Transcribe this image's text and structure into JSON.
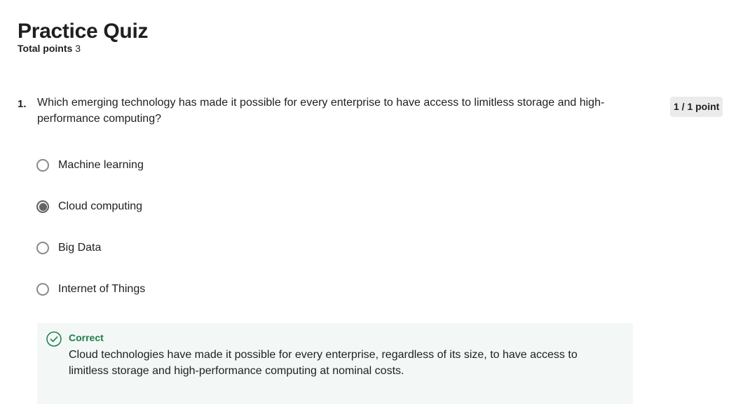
{
  "quiz": {
    "title": "Practice Quiz",
    "total_points_label": "Total points",
    "total_points_value": "3"
  },
  "question": {
    "number": "1.",
    "text": "Which emerging technology has made it possible for every enterprise to have access to limitless storage and high-performance computing?",
    "points": "1 / 1 point",
    "options": [
      {
        "label": "Machine learning",
        "selected": false
      },
      {
        "label": "Cloud computing",
        "selected": true
      },
      {
        "label": "Big Data",
        "selected": false
      },
      {
        "label": "Internet of Things",
        "selected": false
      }
    ]
  },
  "feedback": {
    "status": "Correct",
    "text": "Cloud technologies have made it possible for every enterprise, regardless of its size, to have access to limitless storage and high-performance computing at nominal costs.",
    "color": "#1e7d4c",
    "icon": "check-circle-icon"
  }
}
